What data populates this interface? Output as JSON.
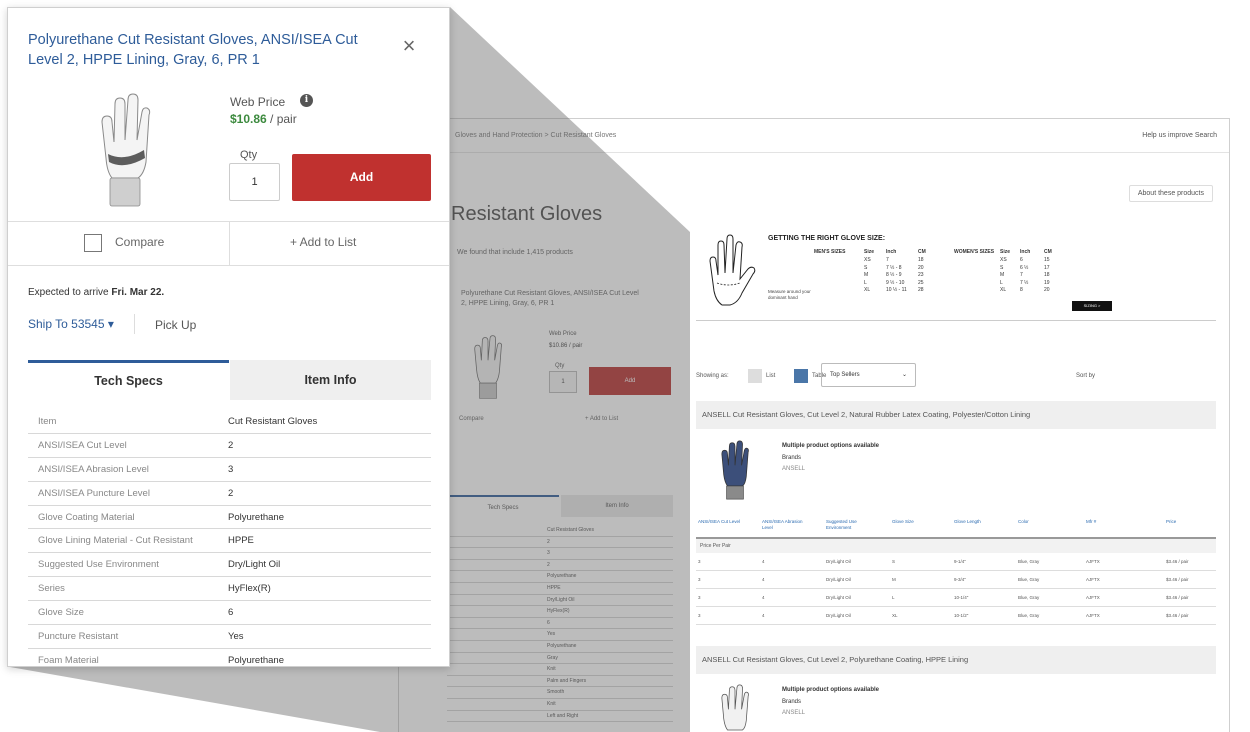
{
  "background_page": {
    "breadcrumb": "Gloves and Hand Protection > Cut Resistant Gloves",
    "help_link": "Help us improve Search",
    "title": "Resistant Gloves",
    "found_text": "We found that include 1,415 products",
    "about_link": "About these products",
    "card": {
      "title": "Polyurethane Cut Resistant Gloves, ANSI/ISEA Cut Level 2, HPPE Lining, Gray, 6, PR 1",
      "web_price": "Web Price",
      "price": "$10.86 / pair",
      "qty_label": "Qty",
      "qty": "1",
      "add": "Add",
      "compare": "Compare",
      "add_to_list": "+ Add to List",
      "arrive": "Expected to arrive Fri. Mar 22.",
      "ship_to": "Ship To",
      "pick_up": "Pick Up",
      "tab_specs": "Tech Specs",
      "tab_info": "Item Info",
      "rows": [
        "Cut Resistant Gloves",
        "2",
        "3",
        "2",
        "Polyurethane",
        "HPPE",
        "Dry/Light Oil",
        "HyFlex(R)",
        "6",
        "Yes",
        "Polyurethane",
        "Gray",
        "Knit",
        "Palm and Fingers",
        "Smooth",
        "Knit",
        "Left and Right"
      ]
    },
    "size_chart": {
      "title": "GETTING THE RIGHT GLOVE SIZE:",
      "mens_label": "MEN'S SIZES",
      "womens_label": "WOMEN'S SIZES",
      "measure_note": "Measure around your dominant hand",
      "button": "SIZING >",
      "header": [
        "Size",
        "Inch",
        "CM"
      ],
      "mens_rows": [
        [
          "XS",
          "7",
          "18"
        ],
        [
          "S",
          "7 ½ - 8",
          "20"
        ],
        [
          "M",
          "8 ½ - 9",
          "23"
        ],
        [
          "L",
          "9 ½ - 10",
          "25"
        ],
        [
          "XL",
          "10 ½ - 11",
          "28"
        ]
      ],
      "womens_rows": [
        [
          "XS",
          "6",
          "15"
        ],
        [
          "S",
          "6 ½",
          "17"
        ],
        [
          "M",
          "7",
          "18"
        ],
        [
          "L",
          "7 ½",
          "19"
        ],
        [
          "XL",
          "8",
          "20"
        ]
      ]
    },
    "view": {
      "label": "Showing as:",
      "list": "List",
      "table": "Table",
      "sort_label": "Sort by",
      "sort_value": "Top Sellers"
    },
    "groups": [
      {
        "title": "ANSELL Cut Resistant Gloves, Cut Level 2, Natural Rubber Latex Coating, Polyester/Cotton Lining",
        "options": "Multiple product options available",
        "brands_label": "Brands",
        "brand": "ANSELL"
      },
      {
        "title": "ANSELL Cut Resistant Gloves, Cut Level 2, Polyurethane Coating, HPPE Lining",
        "options": "Multiple product options available",
        "brands_label": "Brands",
        "brand": "ANSELL"
      }
    ],
    "table": {
      "headers": [
        "ANSI/ISEA Cut Level",
        "ANSI/ISEA Abrasion Level",
        "Suggested Use Environment",
        "Glove Size",
        "Glove Length",
        "Color",
        "Mfr #",
        "Price"
      ],
      "subheader": "Price Per Pair",
      "rows": [
        [
          "3",
          "4",
          "Dry/Light Oil",
          "S",
          "9-1/4\"",
          "Blue, Gray",
          "AJFTX",
          "$3.46 / pair"
        ],
        [
          "3",
          "4",
          "Dry/Light Oil",
          "M",
          "9-3/4\"",
          "Blue, Gray",
          "AJFTX",
          "$3.46 / pair"
        ],
        [
          "3",
          "4",
          "Dry/Light Oil",
          "L",
          "10-1/4\"",
          "Blue, Gray",
          "AJFTX",
          "$3.46 / pair"
        ],
        [
          "3",
          "4",
          "Dry/Light Oil",
          "XL",
          "10-1/2\"",
          "Blue, Gray",
          "AJFTX",
          "$3.46 / pair"
        ]
      ]
    }
  },
  "popup": {
    "title": "Polyurethane Cut Resistant Gloves, ANSI/ISEA Cut Level 2, HPPE Lining, Gray, 6, PR 1",
    "close": "×",
    "web_price_label": "Web Price",
    "info_icon": "i",
    "price": "$10.86",
    "price_unit": " / pair",
    "qty_label": "Qty",
    "qty_value": "1",
    "add_button": "Add",
    "compare_label": "Compare",
    "add_to_list": "+ Add to List",
    "arrive_prefix": "Expected to arrive ",
    "arrive_date": "Fri. Mar 22.",
    "ship_to": "Ship To 53545 ▾",
    "pick_up": "Pick Up",
    "tabs": {
      "specs": "Tech Specs",
      "info": "Item Info"
    },
    "specs": [
      {
        "k": "Item",
        "v": "Cut Resistant Gloves"
      },
      {
        "k": "ANSI/ISEA Cut Level",
        "v": "2"
      },
      {
        "k": "ANSI/ISEA Abrasion Level",
        "v": "3"
      },
      {
        "k": "ANSI/ISEA Puncture Level",
        "v": "2"
      },
      {
        "k": "Glove Coating Material",
        "v": "Polyurethane"
      },
      {
        "k": "Glove Lining Material - Cut Resistant",
        "v": "HPPE"
      },
      {
        "k": "Suggested Use Environment",
        "v": "Dry/Light Oil"
      },
      {
        "k": "Series",
        "v": "HyFlex(R)"
      },
      {
        "k": "Glove Size",
        "v": "6"
      },
      {
        "k": "Puncture Resistant",
        "v": "Yes"
      },
      {
        "k": "Foam Material",
        "v": "Polyurethane"
      }
    ]
  },
  "colors": {
    "accent_blue": "#2e5c99",
    "add_red": "#c0312f",
    "price_green": "#3c8a3e"
  }
}
